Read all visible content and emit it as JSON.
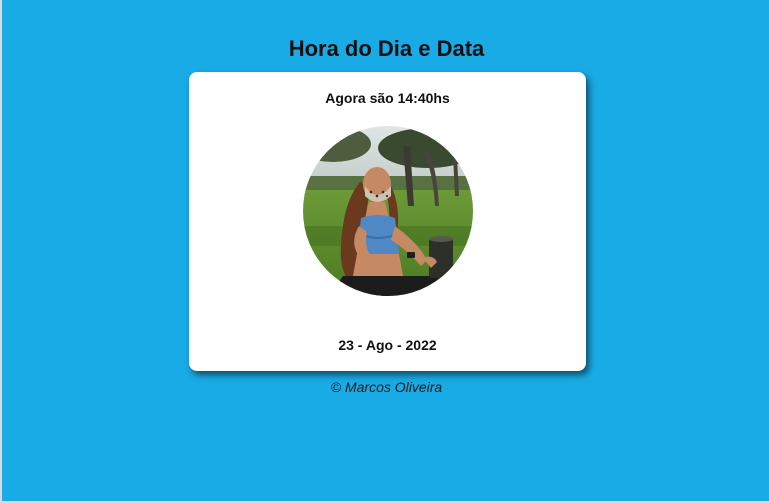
{
  "page": {
    "title": "Hora do Dia e Data",
    "background_color": "#19abe6"
  },
  "card": {
    "time_message": "Agora são 14:40hs",
    "photo_icon": "woman-with-mask-in-park-photo",
    "date_message": "23 - Ago - 2022"
  },
  "footer": {
    "copyright": "© Marcos Oliveira"
  }
}
